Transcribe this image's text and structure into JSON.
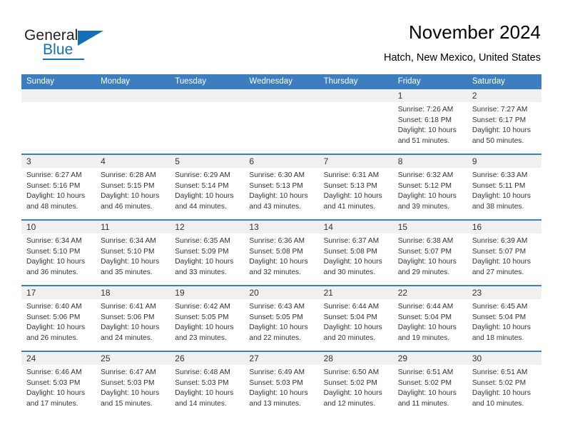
{
  "logo": {
    "word_one": "General",
    "word_two": "Blue",
    "triangle_icon": "triangle-icon",
    "brand_color": "#1270b8"
  },
  "header": {
    "title": "November 2024",
    "subtitle": "Hatch, New Mexico, United States"
  },
  "calendar": {
    "header_color": "#3c7ebf",
    "daynum_band_color": "#f0f0f0",
    "weekdays": [
      "Sunday",
      "Monday",
      "Tuesday",
      "Wednesday",
      "Thursday",
      "Friday",
      "Saturday"
    ],
    "weeks": [
      [
        {
          "day": "",
          "sunrise": "",
          "sunset": "",
          "daylight": ""
        },
        {
          "day": "",
          "sunrise": "",
          "sunset": "",
          "daylight": ""
        },
        {
          "day": "",
          "sunrise": "",
          "sunset": "",
          "daylight": ""
        },
        {
          "day": "",
          "sunrise": "",
          "sunset": "",
          "daylight": ""
        },
        {
          "day": "",
          "sunrise": "",
          "sunset": "",
          "daylight": ""
        },
        {
          "day": "1",
          "sunrise": "Sunrise: 7:26 AM",
          "sunset": "Sunset: 6:18 PM",
          "daylight": "Daylight: 10 hours and 51 minutes."
        },
        {
          "day": "2",
          "sunrise": "Sunrise: 7:27 AM",
          "sunset": "Sunset: 6:17 PM",
          "daylight": "Daylight: 10 hours and 50 minutes."
        }
      ],
      [
        {
          "day": "3",
          "sunrise": "Sunrise: 6:27 AM",
          "sunset": "Sunset: 5:16 PM",
          "daylight": "Daylight: 10 hours and 48 minutes."
        },
        {
          "day": "4",
          "sunrise": "Sunrise: 6:28 AM",
          "sunset": "Sunset: 5:15 PM",
          "daylight": "Daylight: 10 hours and 46 minutes."
        },
        {
          "day": "5",
          "sunrise": "Sunrise: 6:29 AM",
          "sunset": "Sunset: 5:14 PM",
          "daylight": "Daylight: 10 hours and 44 minutes."
        },
        {
          "day": "6",
          "sunrise": "Sunrise: 6:30 AM",
          "sunset": "Sunset: 5:13 PM",
          "daylight": "Daylight: 10 hours and 43 minutes."
        },
        {
          "day": "7",
          "sunrise": "Sunrise: 6:31 AM",
          "sunset": "Sunset: 5:13 PM",
          "daylight": "Daylight: 10 hours and 41 minutes."
        },
        {
          "day": "8",
          "sunrise": "Sunrise: 6:32 AM",
          "sunset": "Sunset: 5:12 PM",
          "daylight": "Daylight: 10 hours and 39 minutes."
        },
        {
          "day": "9",
          "sunrise": "Sunrise: 6:33 AM",
          "sunset": "Sunset: 5:11 PM",
          "daylight": "Daylight: 10 hours and 38 minutes."
        }
      ],
      [
        {
          "day": "10",
          "sunrise": "Sunrise: 6:34 AM",
          "sunset": "Sunset: 5:10 PM",
          "daylight": "Daylight: 10 hours and 36 minutes."
        },
        {
          "day": "11",
          "sunrise": "Sunrise: 6:34 AM",
          "sunset": "Sunset: 5:10 PM",
          "daylight": "Daylight: 10 hours and 35 minutes."
        },
        {
          "day": "12",
          "sunrise": "Sunrise: 6:35 AM",
          "sunset": "Sunset: 5:09 PM",
          "daylight": "Daylight: 10 hours and 33 minutes."
        },
        {
          "day": "13",
          "sunrise": "Sunrise: 6:36 AM",
          "sunset": "Sunset: 5:08 PM",
          "daylight": "Daylight: 10 hours and 32 minutes."
        },
        {
          "day": "14",
          "sunrise": "Sunrise: 6:37 AM",
          "sunset": "Sunset: 5:08 PM",
          "daylight": "Daylight: 10 hours and 30 minutes."
        },
        {
          "day": "15",
          "sunrise": "Sunrise: 6:38 AM",
          "sunset": "Sunset: 5:07 PM",
          "daylight": "Daylight: 10 hours and 29 minutes."
        },
        {
          "day": "16",
          "sunrise": "Sunrise: 6:39 AM",
          "sunset": "Sunset: 5:07 PM",
          "daylight": "Daylight: 10 hours and 27 minutes."
        }
      ],
      [
        {
          "day": "17",
          "sunrise": "Sunrise: 6:40 AM",
          "sunset": "Sunset: 5:06 PM",
          "daylight": "Daylight: 10 hours and 26 minutes."
        },
        {
          "day": "18",
          "sunrise": "Sunrise: 6:41 AM",
          "sunset": "Sunset: 5:06 PM",
          "daylight": "Daylight: 10 hours and 24 minutes."
        },
        {
          "day": "19",
          "sunrise": "Sunrise: 6:42 AM",
          "sunset": "Sunset: 5:05 PM",
          "daylight": "Daylight: 10 hours and 23 minutes."
        },
        {
          "day": "20",
          "sunrise": "Sunrise: 6:43 AM",
          "sunset": "Sunset: 5:05 PM",
          "daylight": "Daylight: 10 hours and 22 minutes."
        },
        {
          "day": "21",
          "sunrise": "Sunrise: 6:44 AM",
          "sunset": "Sunset: 5:04 PM",
          "daylight": "Daylight: 10 hours and 20 minutes."
        },
        {
          "day": "22",
          "sunrise": "Sunrise: 6:44 AM",
          "sunset": "Sunset: 5:04 PM",
          "daylight": "Daylight: 10 hours and 19 minutes."
        },
        {
          "day": "23",
          "sunrise": "Sunrise: 6:45 AM",
          "sunset": "Sunset: 5:04 PM",
          "daylight": "Daylight: 10 hours and 18 minutes."
        }
      ],
      [
        {
          "day": "24",
          "sunrise": "Sunrise: 6:46 AM",
          "sunset": "Sunset: 5:03 PM",
          "daylight": "Daylight: 10 hours and 17 minutes."
        },
        {
          "day": "25",
          "sunrise": "Sunrise: 6:47 AM",
          "sunset": "Sunset: 5:03 PM",
          "daylight": "Daylight: 10 hours and 15 minutes."
        },
        {
          "day": "26",
          "sunrise": "Sunrise: 6:48 AM",
          "sunset": "Sunset: 5:03 PM",
          "daylight": "Daylight: 10 hours and 14 minutes."
        },
        {
          "day": "27",
          "sunrise": "Sunrise: 6:49 AM",
          "sunset": "Sunset: 5:03 PM",
          "daylight": "Daylight: 10 hours and 13 minutes."
        },
        {
          "day": "28",
          "sunrise": "Sunrise: 6:50 AM",
          "sunset": "Sunset: 5:02 PM",
          "daylight": "Daylight: 10 hours and 12 minutes."
        },
        {
          "day": "29",
          "sunrise": "Sunrise: 6:51 AM",
          "sunset": "Sunset: 5:02 PM",
          "daylight": "Daylight: 10 hours and 11 minutes."
        },
        {
          "day": "30",
          "sunrise": "Sunrise: 6:51 AM",
          "sunset": "Sunset: 5:02 PM",
          "daylight": "Daylight: 10 hours and 10 minutes."
        }
      ]
    ]
  }
}
